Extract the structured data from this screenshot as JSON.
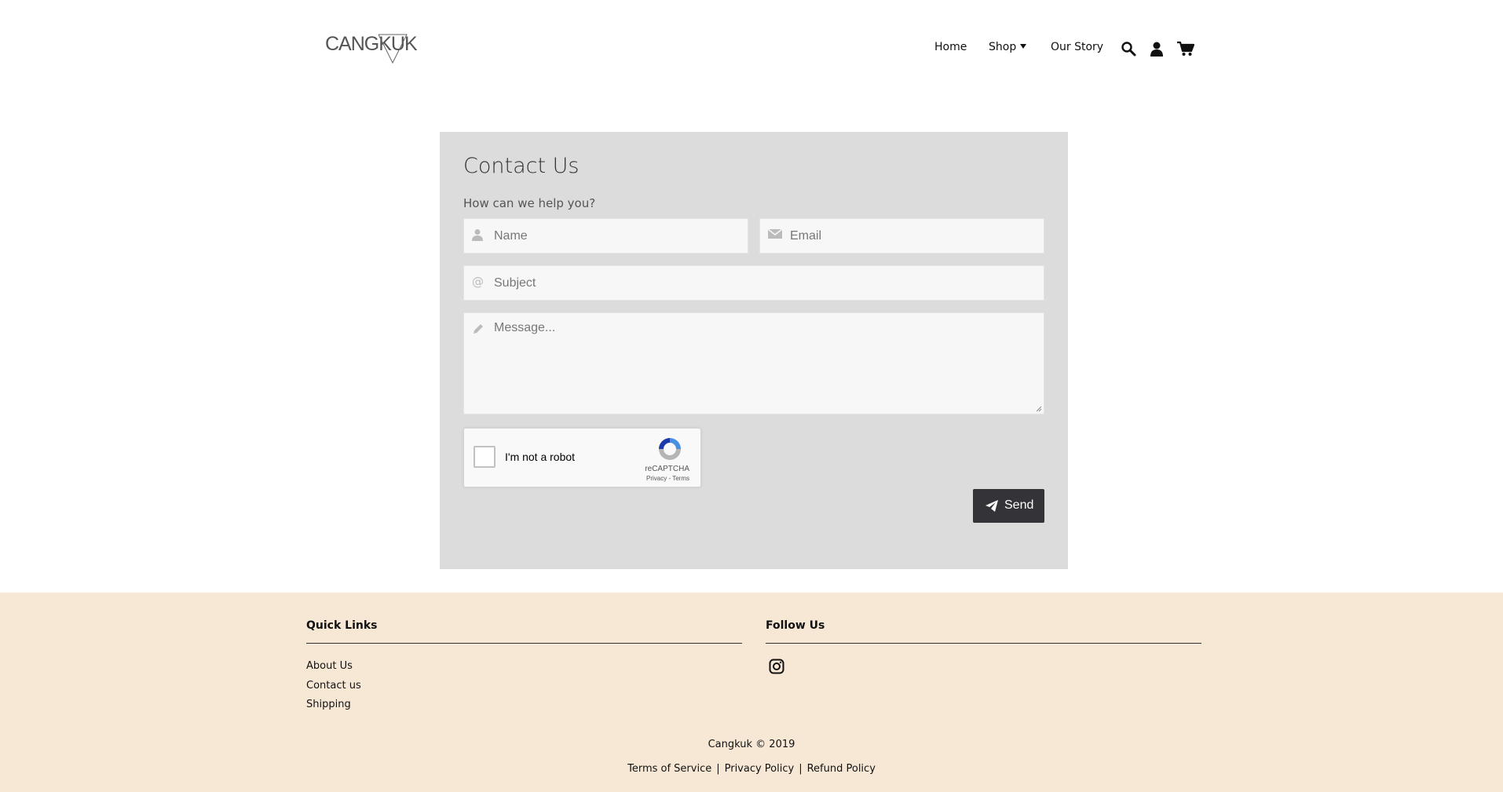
{
  "header": {
    "logo_text": "CANGKUK",
    "nav": {
      "home": "Home",
      "shop": "Shop",
      "our_story": "Our Story"
    },
    "icons": [
      "search-icon",
      "account-icon",
      "cart-icon"
    ]
  },
  "contact": {
    "title": "Contact Us",
    "subtitle": "How can we help you?",
    "name_placeholder": "Name",
    "email_placeholder": "Email",
    "subject_placeholder": "Subject",
    "message_placeholder": "Message...",
    "captcha": {
      "label": "I'm not a robot",
      "brand": "reCAPTCHA",
      "terms": "Privacy - Terms"
    },
    "send_label": "Send"
  },
  "footer": {
    "quick_links_title": "Quick Links",
    "quick_links": [
      "About Us",
      "Contact us",
      "Shipping"
    ],
    "follow_us_title": "Follow Us",
    "copyright": "Cangkuk © 2019",
    "legal": {
      "terms": "Terms of Service",
      "sep": "|",
      "privacy": "Privacy Policy",
      "refund": "Refund Policy"
    }
  },
  "colors": {
    "card_bg": "#dcdcdc",
    "footer_bg": "#f7e8d6",
    "button_bg": "#333338"
  }
}
